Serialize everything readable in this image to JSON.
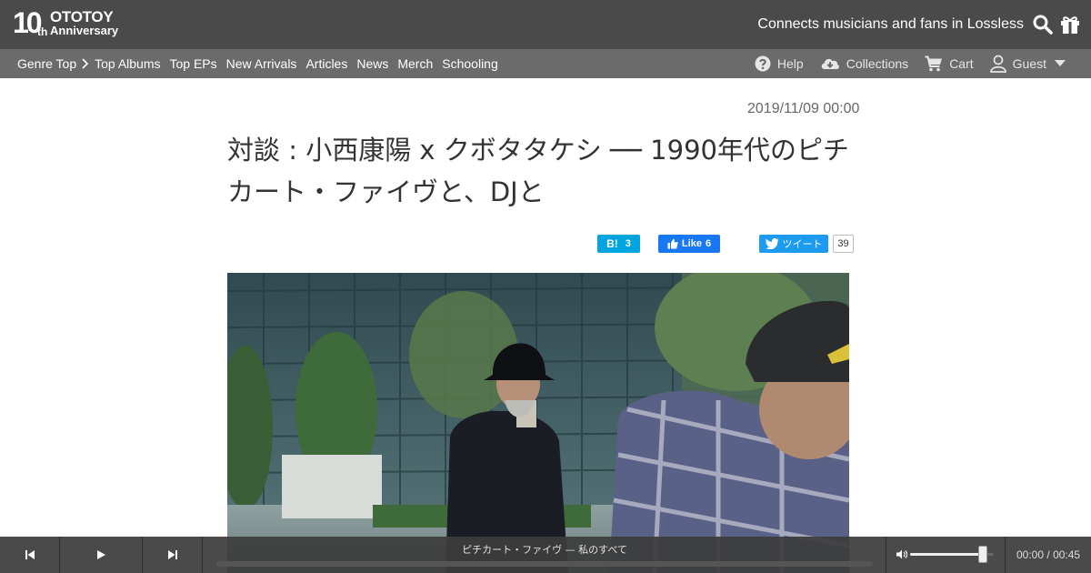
{
  "header": {
    "logo": {
      "ten": "10",
      "th": "th",
      "brand": "OTOTOY",
      "anniversary": "Anniversary"
    },
    "tagline": "Connects musicians and fans in Lossless",
    "icons": [
      "search-icon",
      "gift-icon"
    ]
  },
  "nav": {
    "items": [
      {
        "label": "Genre Top"
      },
      {
        "label": "Top Albums"
      },
      {
        "label": "Top EPs"
      },
      {
        "label": "New Arrivals"
      },
      {
        "label": "Articles"
      },
      {
        "label": "News"
      },
      {
        "label": "Merch"
      },
      {
        "label": "Schooling"
      }
    ],
    "right": {
      "help": "Help",
      "collections": "Collections",
      "cart": "Cart",
      "user": "Guest"
    }
  },
  "article": {
    "date": "2019/11/09 00:00",
    "title_line1": "対談 : 小西康陽 x クボタタケシ ── 1990年代のピチ",
    "title_line2": "カート・ファイヴと、DJと"
  },
  "share": {
    "hatena": {
      "mark": "B!",
      "count": "3"
    },
    "facebook": {
      "label": "Like",
      "count": "6"
    },
    "twitter": {
      "label": "ツイート",
      "count": "39"
    }
  },
  "player": {
    "track": "ピチカート・ファイヴ — 私のすべて",
    "time_current": "00:00",
    "time_separator": "/",
    "time_total": "00:45",
    "volume": 0.92,
    "progress": 0
  },
  "colors": {
    "topbar": "#4a4a4a",
    "navbar": "#6b6b6b",
    "hatena": "#00a4de",
    "facebook": "#1877f2",
    "twitter": "#1d9bf0"
  }
}
